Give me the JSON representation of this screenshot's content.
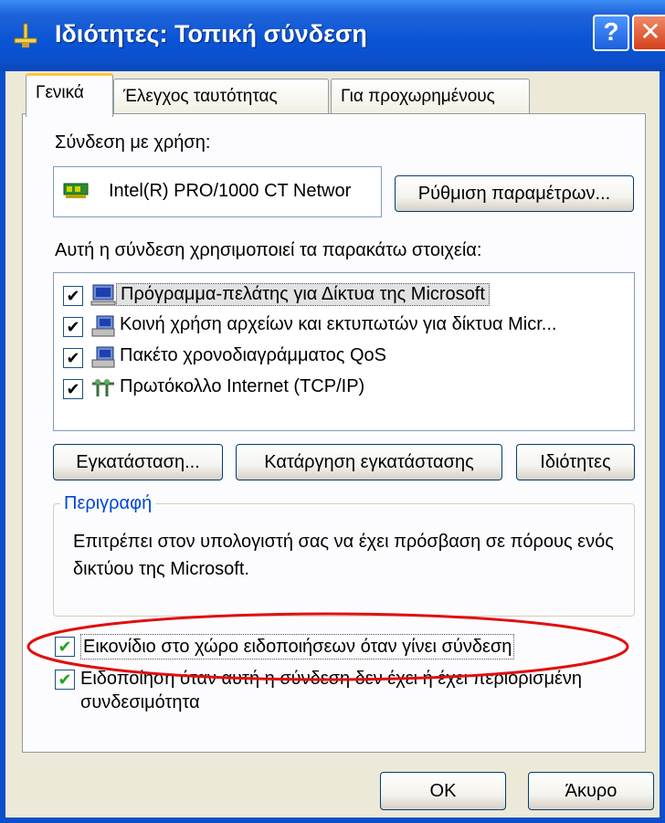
{
  "window": {
    "title": "Ιδιότητες: Τοπική σύνδεση",
    "help_glyph": "?",
    "close_glyph": "✕"
  },
  "tabs": [
    {
      "label": "Γενικά",
      "active": true
    },
    {
      "label": "Έλεγχος ταυτότητας",
      "active": false
    },
    {
      "label": "Για προχωρημένους",
      "active": false
    }
  ],
  "general": {
    "connect_using_label": "Σύνδεση με χρήση:",
    "adapter_name": "Intel(R) PRO/1000 CT Networ",
    "configure_button": "Ρύθμιση παραμέτρων...",
    "items_label": "Αυτή η σύνδεση χρησιμοποιεί τα παρακάτω στοιχεία:",
    "items": [
      {
        "label": "Πρόγραμμα-πελάτης για Δίκτυα της Microsoft",
        "checked": true,
        "selected": true,
        "icon": "client-icon"
      },
      {
        "label": "Κοινή χρήση αρχείων και εκτυπωτών για δίκτυα Micr...",
        "checked": true,
        "selected": false,
        "icon": "service-icon"
      },
      {
        "label": "Πακέτο χρονοδιαγράμματος QoS",
        "checked": true,
        "selected": false,
        "icon": "service-icon"
      },
      {
        "label": "Πρωτόκολλο Internet (TCP/IP)",
        "checked": true,
        "selected": false,
        "icon": "protocol-icon"
      }
    ],
    "install_button": "Εγκατάσταση...",
    "uninstall_button": "Κατάργηση εγκατάστασης",
    "properties_button": "Ιδιότητες",
    "description_title": "Περιγραφή",
    "description_text": "Επιτρέπει στον υπολογιστή σας να έχει πρόσβαση σε πόρους ενός δικτύου της Microsoft.",
    "show_icon_option": {
      "label": "Εικονίδιο στο χώρο ειδοποιήσεων όταν γίνει σύνδεση",
      "checked": true
    },
    "notify_option": {
      "label": "Ειδοποίηση όταν αυτή η σύνδεση δεν έχει ή έχει περιορισμένη συνδεσιμότητα",
      "checked": true
    },
    "checkmark": "✔"
  },
  "footer": {
    "ok_button": "OK",
    "cancel_button": "Άκυρο"
  },
  "colors": {
    "titlebar": "#0b4fca",
    "dialog": "#ece9d8",
    "highlight_ellipse": "#e01010",
    "group_title": "#0046d5"
  }
}
